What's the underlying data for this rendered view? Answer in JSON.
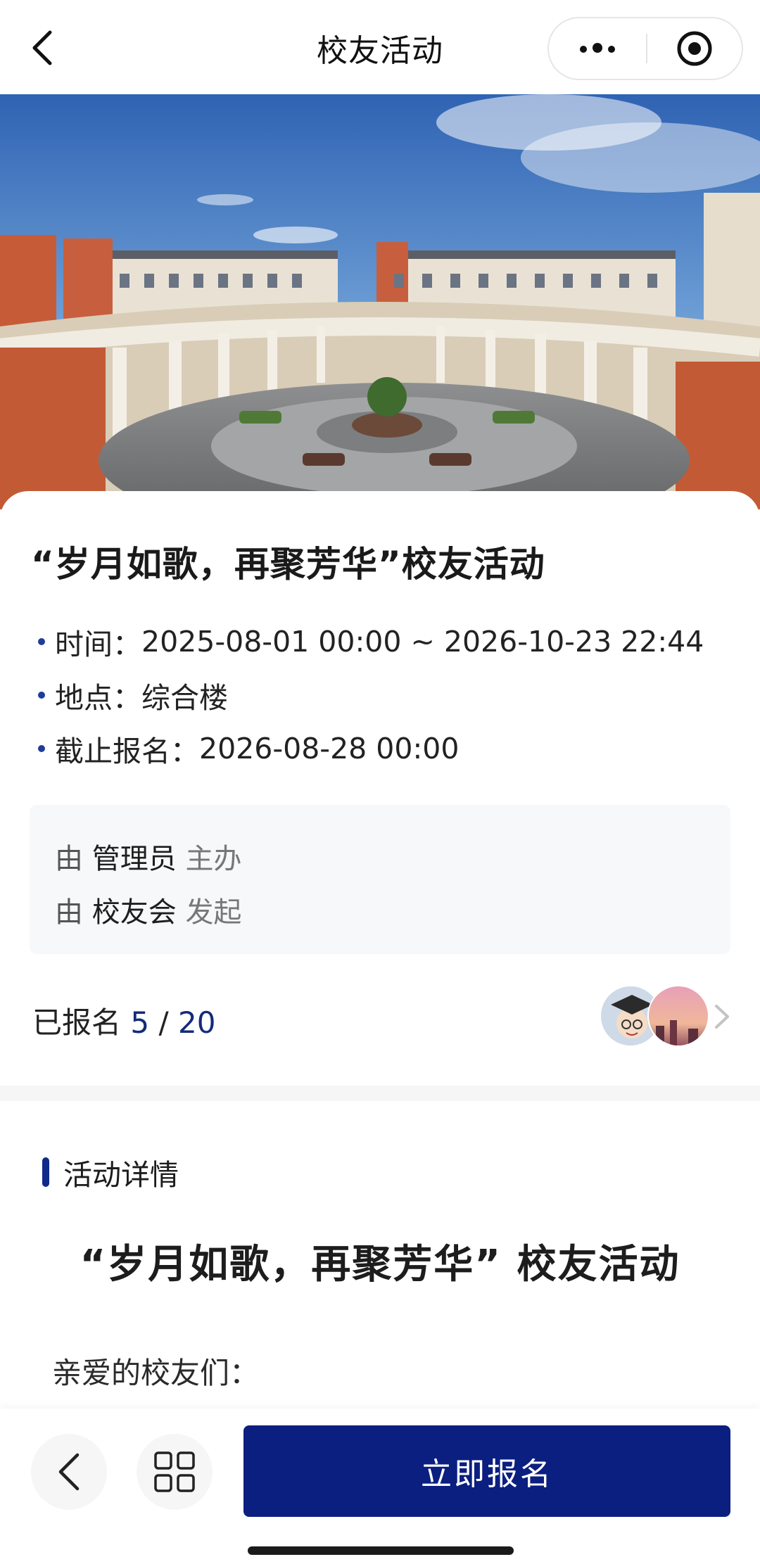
{
  "nav": {
    "title": "校友活动",
    "back_icon": "chevron-left-icon",
    "more_icon": "more-dots-icon",
    "close_icon": "target-close-icon"
  },
  "hero": {
    "image": "campus-building-courtyard"
  },
  "event": {
    "title": "“岁月如歌，再聚芳华”校友活动",
    "time_label": "时间：",
    "time_value": "2025-08-01 00:00 ~ 2026-10-23 22:44",
    "place_label": "地点：",
    "place_value": "综合楼",
    "deadline_label": "截止报名：",
    "deadline_value": "2026-08-28 00:00"
  },
  "organizer": {
    "host_prefix": "由",
    "host_name": "管理员",
    "host_role": "主办",
    "initiator_prefix": "由",
    "initiator_name": "校友会",
    "initiator_role": "发起"
  },
  "signup": {
    "label": "已报名",
    "count": "5",
    "separator": "/",
    "total": "20",
    "chevron_icon": "chevron-right-icon"
  },
  "details": {
    "section_label": "活动详情",
    "title": "“岁月如歌，再聚芳华” 校友活动",
    "greeting": "亲爱的校友们："
  },
  "bottom": {
    "back_icon": "chevron-left-icon",
    "grid_icon": "grid-icon",
    "signup_button": "立即报名"
  },
  "colors": {
    "accent": "#0b1f80",
    "bullet": "#1f3c9a",
    "count": "#142a7a"
  }
}
